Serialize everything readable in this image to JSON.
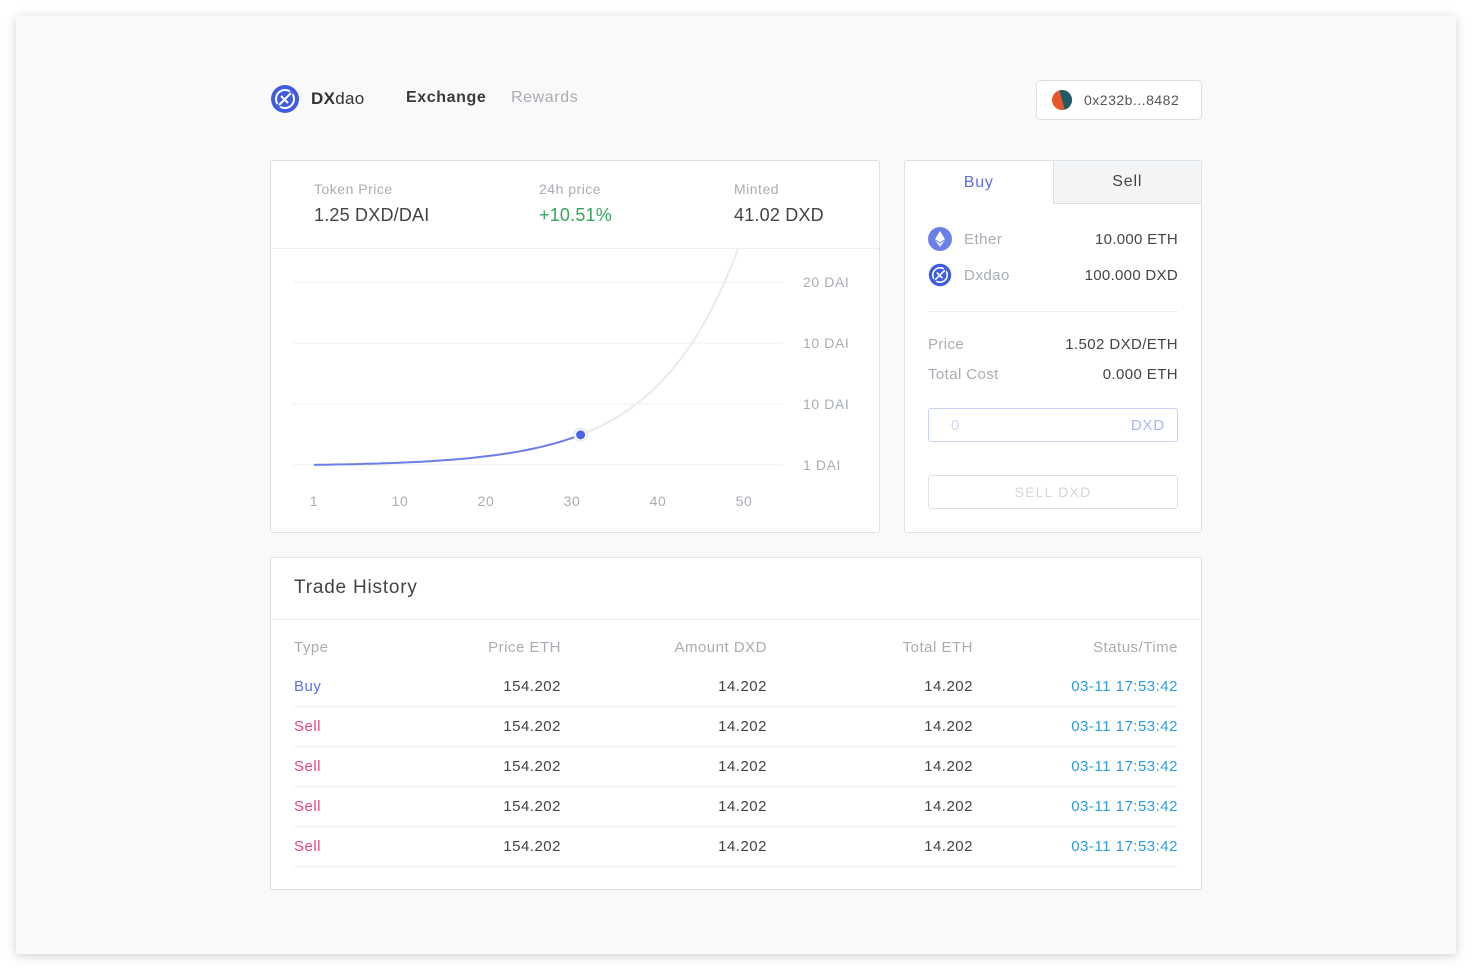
{
  "brand": {
    "strong": "DX",
    "light": "dao"
  },
  "nav": {
    "exchange": "Exchange",
    "rewards": "Rewards"
  },
  "wallet": {
    "address": "0x232b...8482"
  },
  "stats": {
    "token_price_label": "Token Price",
    "token_price_value": "1.25 DXD/DAI",
    "change_label": "24h price",
    "change_value": "+10.51%",
    "minted_label": "Minted",
    "minted_value": "41.02 DXD"
  },
  "chart_data": {
    "type": "line",
    "x_ticks": [
      "1",
      "10",
      "20",
      "30",
      "40",
      "50"
    ],
    "y_ticks": [
      "20 DAI",
      "10 DAI",
      "10 DAI",
      "1 DAI"
    ],
    "marker_x": 32,
    "curve": "bonding-curve"
  },
  "trade": {
    "tab_buy": "Buy",
    "tab_sell": "Sell",
    "assets": [
      {
        "name": "Ether",
        "amount": "10.000 ETH",
        "icon": "ether-icon"
      },
      {
        "name": "Dxdao",
        "amount": "100.000 DXD",
        "icon": "dxdao-icon"
      }
    ],
    "price_label": "Price",
    "price_value": "1.502 DXD/ETH",
    "total_cost_label": "Total Cost",
    "total_cost_value": "0.000 ETH",
    "amount_placeholder": "0",
    "amount_unit": "DXD",
    "sell_button": "SELL DXD"
  },
  "history": {
    "title": "Trade History",
    "columns": [
      "Type",
      "Price ETH",
      "Amount DXD",
      "Total ETH",
      "Status/Time"
    ],
    "rows": [
      {
        "type": "Buy",
        "price": "154.202",
        "amount": "14.202",
        "total": "14.202",
        "time": "03-11 17:53:42"
      },
      {
        "type": "Sell",
        "price": "154.202",
        "amount": "14.202",
        "total": "14.202",
        "time": "03-11 17:53:42"
      },
      {
        "type": "Sell",
        "price": "154.202",
        "amount": "14.202",
        "total": "14.202",
        "time": "03-11 17:53:42"
      },
      {
        "type": "Sell",
        "price": "154.202",
        "amount": "14.202",
        "total": "14.202",
        "time": "03-11 17:53:42"
      },
      {
        "type": "Sell",
        "price": "154.202",
        "amount": "14.202",
        "total": "14.202",
        "time": "03-11 17:53:42"
      }
    ]
  },
  "colors": {
    "accent": "#5b6fe8",
    "positive": "#33a65b",
    "sell": "#e6457a",
    "time": "#2d9be0"
  }
}
